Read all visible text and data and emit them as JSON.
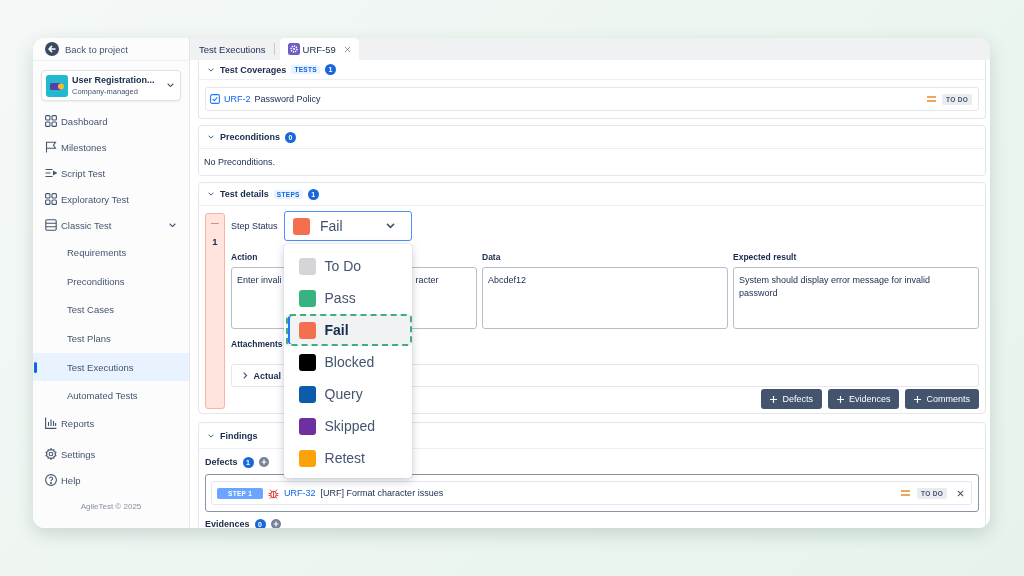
{
  "sidebar": {
    "back_link": "Back to project",
    "project": {
      "name": "User Registration...",
      "type": "Company-managed"
    },
    "nav": [
      {
        "label": "Dashboard",
        "selected": false
      },
      {
        "label": "Milestones",
        "selected": false
      },
      {
        "label": "Script Test",
        "selected": false
      },
      {
        "label": "Exploratory Test",
        "selected": false
      },
      {
        "label": "Classic Test",
        "selected": false,
        "expanded": true,
        "children": [
          {
            "label": "Requirements",
            "selected": false
          },
          {
            "label": "Preconditions",
            "selected": false
          },
          {
            "label": "Test Cases",
            "selected": false
          },
          {
            "label": "Test Plans",
            "selected": false
          },
          {
            "label": "Test Executions",
            "selected": true
          },
          {
            "label": "Automated Tests",
            "selected": false
          }
        ]
      },
      {
        "label": "Reports",
        "selected": false
      },
      {
        "label": "Settings",
        "selected": false
      },
      {
        "label": "Help",
        "selected": false
      }
    ],
    "footer": "AgileTest © 2025"
  },
  "tabs": [
    {
      "kind": "list",
      "label": "Test Executions",
      "selected": false,
      "closable": false
    },
    {
      "kind": "issue",
      "label": "URF-59",
      "selected": true,
      "closable": true
    }
  ],
  "sections": [
    {
      "kind": "coverage",
      "title": "Test Coverages",
      "tag": "TESTS",
      "count": "1",
      "expanded": true,
      "items": [
        {
          "key": "URF-2",
          "summary": "Password Policy",
          "status": "TO DO"
        }
      ]
    },
    {
      "kind": "text",
      "title": "Preconditions",
      "count": "0",
      "expanded": true,
      "text": "No Preconditions."
    },
    {
      "kind": "steps",
      "title": "Test details",
      "tag": "STEPS",
      "count": "1",
      "expanded": true,
      "steps": [
        {
          "number": "1",
          "expanded": true,
          "status_field": {
            "label": "Step Status",
            "value": "Fail",
            "color": "#f36f50",
            "open": true,
            "options": [
              {
                "label": "To Do",
                "color": "#d4d5d8",
                "selected": false
              },
              {
                "label": "Pass",
                "color": "#36b37e",
                "selected": false
              },
              {
                "label": "Fail",
                "color": "#f36f50",
                "selected": true
              },
              {
                "label": "Blocked",
                "color": "#000000",
                "selected": false
              },
              {
                "label": "Query",
                "color": "#0b5cad",
                "selected": false
              },
              {
                "label": "Skipped",
                "color": "#6e2fa0",
                "selected": false
              },
              {
                "label": "Retest",
                "color": "#fca30b",
                "selected": false
              }
            ]
          },
          "fields": [
            {
              "label": "Action",
              "text_parts": [
                "Enter invali",
                "racter"
              ]
            },
            {
              "label": "Data",
              "text_parts": [
                "Abcdef12"
              ]
            },
            {
              "label": "Expected result",
              "text_parts": [
                "System should display error message for invalid password"
              ]
            }
          ],
          "attachments_label": "Attachments",
          "actual": {
            "label": "Actual",
            "expanded": false
          },
          "buttons": [
            "Defects",
            "Evidences",
            "Comments"
          ]
        }
      ]
    },
    {
      "kind": "findings",
      "title": "Findings",
      "expanded": true,
      "groups": [
        {
          "label": "Defects",
          "count": "1",
          "items": [
            {
              "step": "STEP 1",
              "key": "URF-32",
              "summary": "[URF] Format character issues",
              "status": "TO DO",
              "removable": true
            }
          ]
        },
        {
          "label": "Evidences",
          "count": "0"
        }
      ]
    }
  ]
}
